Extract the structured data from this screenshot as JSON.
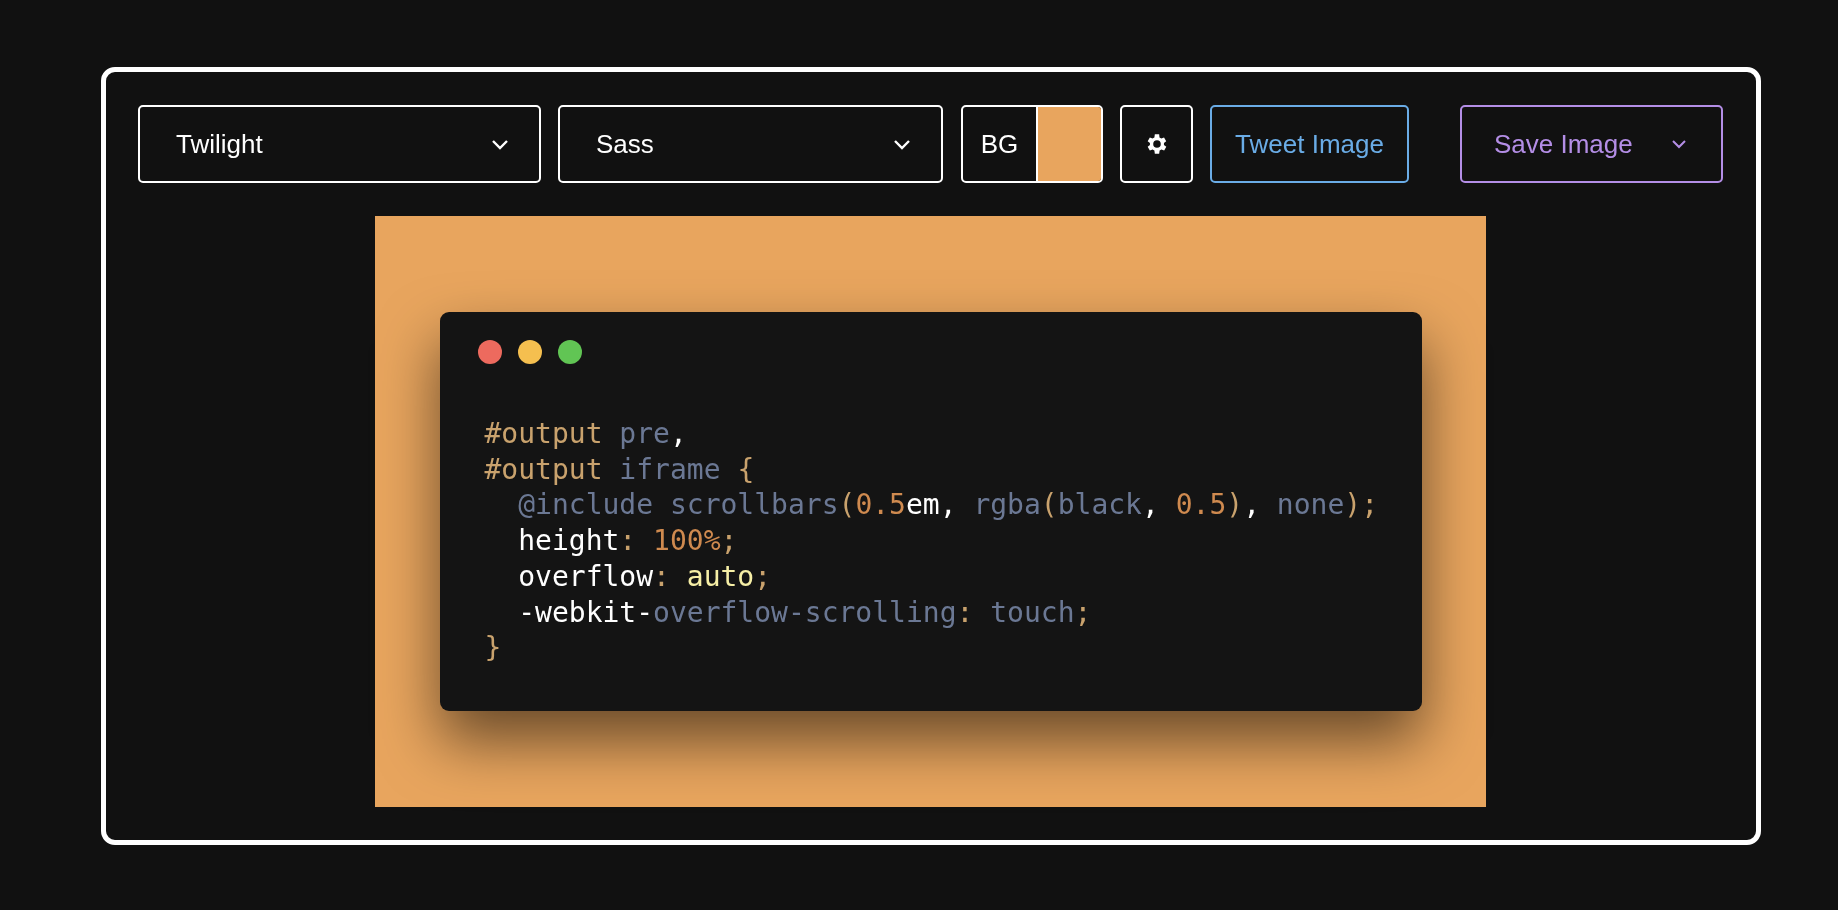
{
  "toolbar": {
    "theme_select": {
      "value": "Twilight"
    },
    "language_select": {
      "value": "Sass"
    },
    "background": {
      "label": "BG",
      "color": "#e8a55e"
    },
    "tweet_button": {
      "label": "Tweet Image"
    },
    "save_button": {
      "label": "Save Image"
    }
  },
  "code_window": {
    "lines": [
      {
        "tokens": [
          {
            "text": "#output ",
            "color": "#c9a26d"
          },
          {
            "text": "pre",
            "color": "#6b7894"
          },
          {
            "text": ",",
            "color": "#ffffff"
          }
        ]
      },
      {
        "tokens": [
          {
            "text": "#output ",
            "color": "#c9a26d"
          },
          {
            "text": "iframe ",
            "color": "#6b7894"
          },
          {
            "text": "{",
            "color": "#c9a26d"
          }
        ]
      },
      {
        "tokens": [
          {
            "text": "  @include scrollbars",
            "color": "#6b7894"
          },
          {
            "text": "(",
            "color": "#c9a26d"
          },
          {
            "text": "0.5",
            "color": "#cf8a4f"
          },
          {
            "text": "em, ",
            "color": "#ffffff"
          },
          {
            "text": "rgba",
            "color": "#6b7894"
          },
          {
            "text": "(",
            "color": "#c9a26d"
          },
          {
            "text": "black",
            "color": "#6b7894"
          },
          {
            "text": ", ",
            "color": "#ffffff"
          },
          {
            "text": "0.5",
            "color": "#cf8a4f"
          },
          {
            "text": ")",
            "color": "#c9a26d"
          },
          {
            "text": ", ",
            "color": "#ffffff"
          },
          {
            "text": "none",
            "color": "#6b7894"
          },
          {
            "text": ");",
            "color": "#c9a26d"
          }
        ]
      },
      {
        "tokens": [
          {
            "text": "  height",
            "color": "#ffffff"
          },
          {
            "text": ": ",
            "color": "#c9a26d"
          },
          {
            "text": "100%",
            "color": "#cf8a4f"
          },
          {
            "text": ";",
            "color": "#c9a26d"
          }
        ]
      },
      {
        "tokens": [
          {
            "text": "  overflow",
            "color": "#ffffff"
          },
          {
            "text": ": ",
            "color": "#c9a26d"
          },
          {
            "text": "auto",
            "color": "#f6efa6"
          },
          {
            "text": ";",
            "color": "#c9a26d"
          }
        ]
      },
      {
        "tokens": [
          {
            "text": "  -webkit-",
            "color": "#ffffff"
          },
          {
            "text": "overflow-scrolling",
            "color": "#6b7894"
          },
          {
            "text": ": ",
            "color": "#c9a26d"
          },
          {
            "text": "touch",
            "color": "#6b7894"
          },
          {
            "text": ";",
            "color": "#c9a26d"
          }
        ]
      },
      {
        "tokens": [
          {
            "text": "}",
            "color": "#c9a26d"
          }
        ]
      }
    ]
  }
}
